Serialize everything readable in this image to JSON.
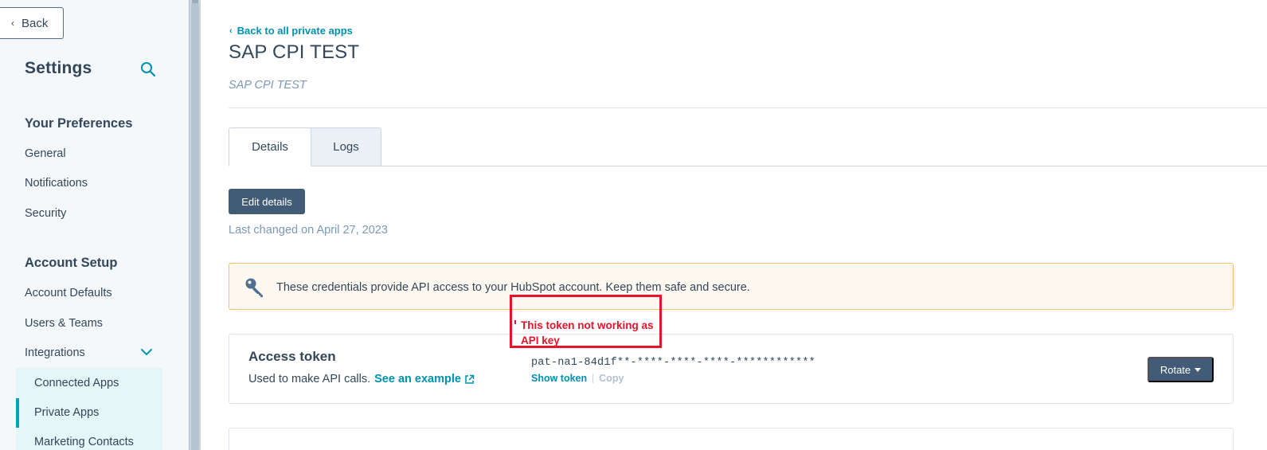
{
  "sidebar": {
    "back_label": "Back",
    "title": "Settings",
    "sections": [
      {
        "title": "Your Preferences",
        "items": [
          "General",
          "Notifications",
          "Security"
        ]
      },
      {
        "title": "Account Setup",
        "items": [
          "Account Defaults",
          "Users & Teams",
          "Integrations"
        ]
      }
    ],
    "sub_items": [
      "Connected Apps",
      "Private Apps",
      "Marketing Contacts"
    ],
    "active_item": "Private Apps",
    "icons": {
      "search": "search-icon",
      "expand": "chevron-down-icon"
    }
  },
  "header": {
    "back_link": "Back to all private apps",
    "title": "SAP CPI TEST",
    "subtitle": "SAP CPI TEST"
  },
  "tabs": [
    {
      "label": "Details",
      "active": true
    },
    {
      "label": "Logs",
      "active": false
    }
  ],
  "actions": {
    "edit_label": "Edit details",
    "last_changed": "Last changed on April 27, 2023"
  },
  "alert": {
    "icon": "key-icon",
    "text": "These credentials provide API access to your HubSpot account. Keep them safe and secure."
  },
  "access_token": {
    "title": "Access token",
    "description": "Used to make API calls.",
    "example_link": "See an example",
    "value": "pat-na1-84d1f**-****-****-****-************",
    "show_label": "Show token",
    "copy_label": "Copy",
    "rotate_label": "Rotate"
  },
  "annotation": {
    "text": "This token not working as API key",
    "color": "#e5142a"
  },
  "colors": {
    "accent": "#0091ae",
    "primary_button": "#425b76",
    "sidebar_bg": "#f5f8fa",
    "active_indicator": "#00a4bd"
  }
}
